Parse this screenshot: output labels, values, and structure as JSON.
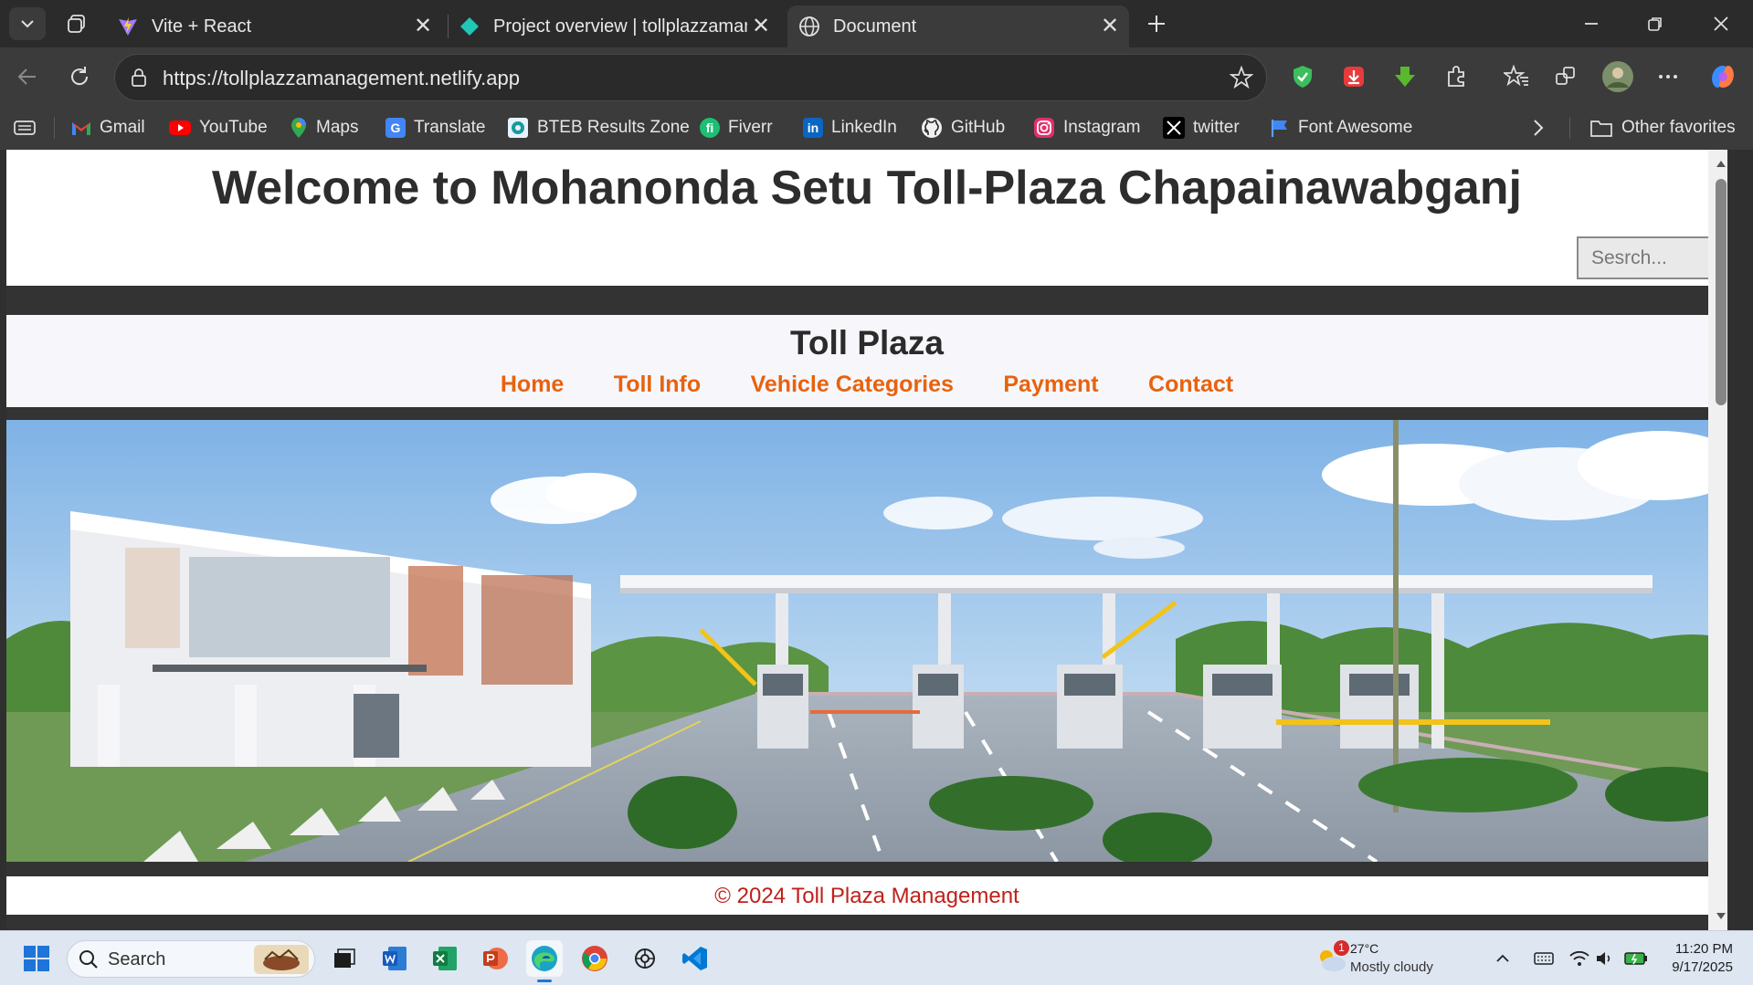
{
  "tabs": [
    {
      "title": "Vite + React",
      "icon": "vite-icon"
    },
    {
      "title": "Project overview | tollplazzamanag",
      "icon": "netlify-icon"
    },
    {
      "title": "Document",
      "icon": "globe-icon",
      "active": true
    }
  ],
  "address": {
    "url": "https://tollplazzamanagement.netlify.app"
  },
  "bookmarks": [
    {
      "label": "Gmail"
    },
    {
      "label": "YouTube"
    },
    {
      "label": "Maps"
    },
    {
      "label": "Translate"
    },
    {
      "label": "BTEB Results Zone"
    },
    {
      "label": "Fiverr"
    },
    {
      "label": "LinkedIn"
    },
    {
      "label": "GitHub"
    },
    {
      "label": "Instagram"
    },
    {
      "label": "twitter"
    },
    {
      "label": "Font Awesome"
    }
  ],
  "other_favorites": "Other favorites",
  "page": {
    "welcome": "Welcome to Mohanonda Setu Toll-Plaza Chapainawabganj",
    "search_placeholder": "Sesrch...",
    "brand": "Toll Plaza",
    "nav": [
      "Home",
      "Toll Info",
      "Vehicle Categories",
      "Payment",
      "Contact"
    ],
    "footer": "© 2024 Toll Plaza Management"
  },
  "taskbar": {
    "search": "Search",
    "weather_temp": "27°C",
    "weather_desc": "Mostly cloudy",
    "weather_badge": "1",
    "time": "11:20 PM",
    "date": "9/17/2025"
  },
  "colors": {
    "nav_link": "#e8620e",
    "footer_text": "#c0201a",
    "page_band": "#333333"
  }
}
